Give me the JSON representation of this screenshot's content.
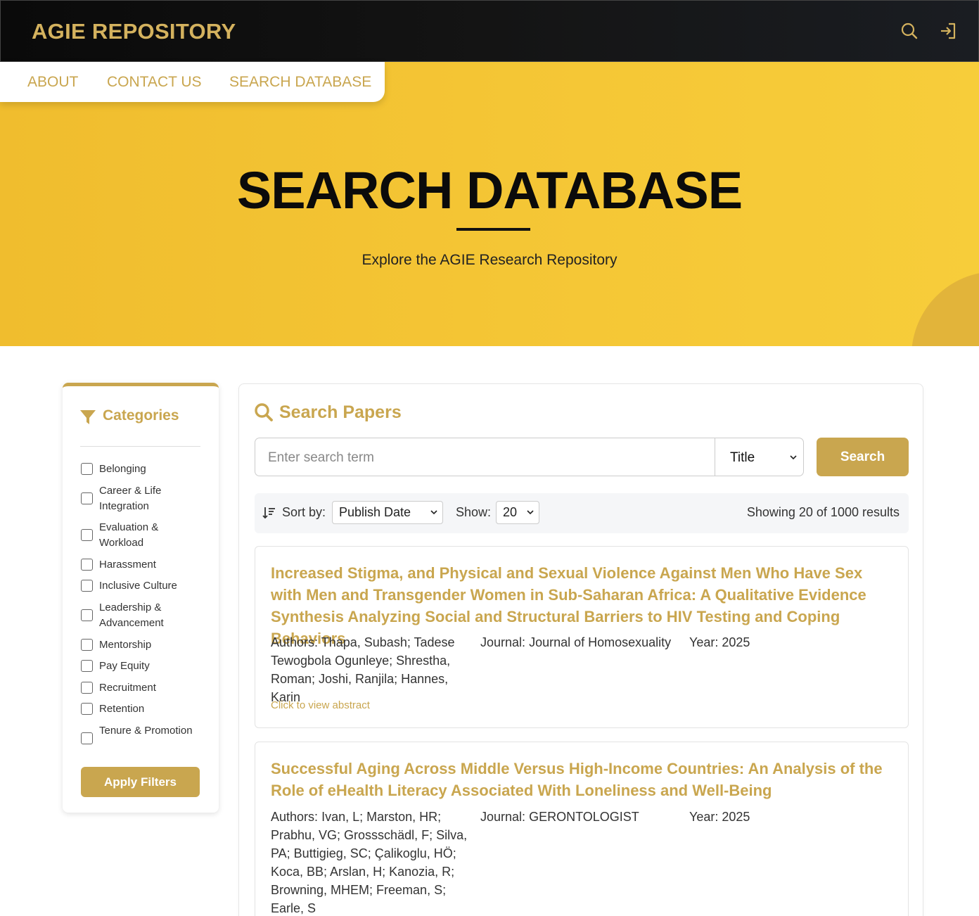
{
  "brand": "AGIE REPOSITORY",
  "topbar": {
    "search_icon": "search-icon",
    "login_icon": "login-icon"
  },
  "subnav": {
    "items": [
      "ABOUT",
      "CONTACT US",
      "SEARCH DATABASE"
    ]
  },
  "hero": {
    "title": "SEARCH DATABASE",
    "subtitle": "Explore the AGIE Research Repository"
  },
  "sidebar": {
    "heading": "Categories",
    "categories": [
      "Belonging",
      "Career & Life Integration",
      "Evaluation & Workload",
      "Harassment",
      "Inclusive Culture",
      "Leadership & Advancement",
      "Mentorship",
      "Pay Equity",
      "Recruitment",
      "Retention",
      "Tenure & Promotion"
    ],
    "apply_label": "Apply Filters"
  },
  "search": {
    "heading": "Search Papers",
    "placeholder": "Enter search term",
    "field_selected": "Title",
    "button_label": "Search"
  },
  "sort": {
    "sort_label": "Sort by:",
    "sort_selected": "Publish Date",
    "show_label": "Show:",
    "show_selected": "20",
    "results_text": "Showing 20 of 1000 results"
  },
  "papers": [
    {
      "title": "Increased Stigma, and Physical and Sexual Violence Against Men Who Have Sex with Men and Transgender Women in Sub-Saharan Africa: A Qualitative Evidence Synthesis Analyzing Social and Structural Barriers to HIV Testing and Coping Behaviors",
      "authors_label": "Authors:",
      "authors": "Thapa, Subash; Tadese Tewogbola Ogunleye; Shrestha, Roman; Joshi, Ranjila; Hannes, Karin",
      "journal_label": "Journal:",
      "journal": "Journal of Homosexuality",
      "year_label": "Year:",
      "year": "2025",
      "abstract_link": "Click to view abstract"
    },
    {
      "title": "Successful Aging Across Middle Versus High-Income Countries: An Analysis of the Role of eHealth Literacy Associated With Loneliness and Well-Being",
      "authors_label": "Authors:",
      "authors": "Ivan, L; Marston, HR; Prabhu, VG; Grossschädl, F; Silva, PA; Buttigieg, SC; Çalikoglu, HÖ; Koca, BB; Arslan, H; Kanozia, R; Browning, MHEM; Freeman, S; Earle, S",
      "journal_label": "Journal:",
      "journal": "GERONTOLOGIST",
      "year_label": "Year:",
      "year": "2025"
    }
  ]
}
